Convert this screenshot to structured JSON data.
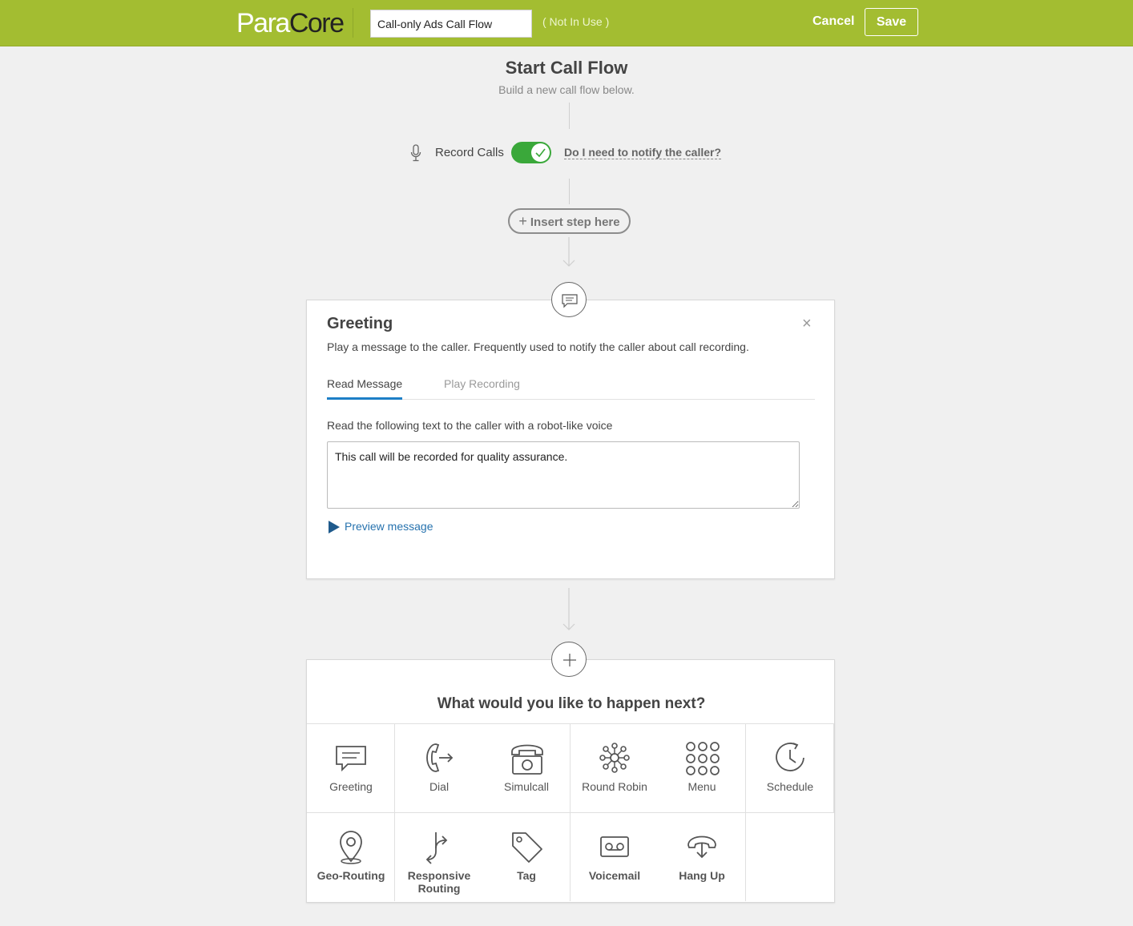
{
  "header": {
    "logo_left": "Para",
    "logo_right": "Core",
    "flow_name": "Call-only Ads Call Flow",
    "usage_status": "( Not In Use )",
    "cancel_label": "Cancel",
    "save_label": "Save",
    "brand_color": "#a3bd31"
  },
  "start": {
    "title": "Start Call Flow",
    "subtitle": "Build a new call flow below."
  },
  "record": {
    "label": "Record Calls",
    "enabled": true,
    "notify_link": "Do I need to notify the caller?"
  },
  "insert_step": {
    "label": "Insert step here"
  },
  "greeting": {
    "title": "Greeting",
    "close_icon": "×",
    "description": "Play a message to the caller. Frequently used to notify the caller about call recording.",
    "tabs": [
      "Read Message",
      "Play Recording"
    ],
    "active_tab": "Read Message",
    "read_label": "Read the following text to the caller with a robot-like voice",
    "message": "This call will be recorded for quality assurance.",
    "preview_label": "Preview message",
    "accent_color": "#1d7fc6"
  },
  "next": {
    "title": "What would you like to happen next?",
    "options": [
      {
        "label": "Greeting",
        "icon": "speech-bubble-icon"
      },
      {
        "label": "Dial",
        "icon": "phone-forward-icon"
      },
      {
        "label": "Simulcall",
        "icon": "desk-phone-icon"
      },
      {
        "label": "Round Robin",
        "icon": "network-icon"
      },
      {
        "label": "Menu",
        "icon": "keypad-icon"
      },
      {
        "label": "Schedule",
        "icon": "clock-icon"
      },
      {
        "label": "Geo-Routing",
        "icon": "map-pin-icon"
      },
      {
        "label": "Responsive Routing",
        "icon": "split-arrow-icon"
      },
      {
        "label": "Tag",
        "icon": "tag-icon"
      },
      {
        "label": "Voicemail",
        "icon": "voicemail-icon"
      },
      {
        "label": "Hang Up",
        "icon": "hang-up-icon"
      }
    ]
  }
}
